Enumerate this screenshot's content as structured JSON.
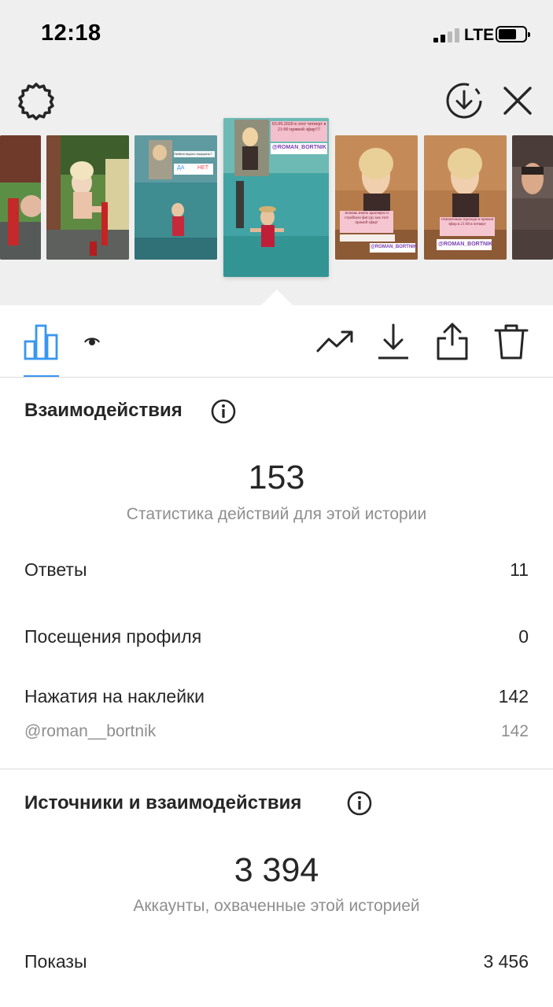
{
  "status_bar": {
    "time": "12:18",
    "network": "LTE"
  },
  "top_bar": {
    "left_icon": "gear-icon",
    "right_icons": [
      "download-circle-icon",
      "close-icon"
    ]
  },
  "story_thumbnails": [
    {
      "name": "story-thumb-1",
      "sticker_text": ""
    },
    {
      "name": "story-thumb-2",
      "sticker_text": ""
    },
    {
      "name": "story-thumb-3",
      "poll_question": "Любите вкусно покушать?",
      "poll_options": [
        "ДА",
        "НЕТ"
      ]
    },
    {
      "name": "story-thumb-4",
      "selected": true,
      "sticker_text": "03.09.2020 в этот четверг в 21:00 прямой эфир!!!",
      "mention": "@ROMAN_BORTNIK"
    },
    {
      "name": "story-thumb-5",
      "sticker_text": "Хочешь иметь красивую и стройную фигуру как этот прямой эфир!",
      "mention": "@ROMAN_BORTNIK"
    },
    {
      "name": "story-thumb-6",
      "sticker_text": "Обязательно приходи в прямой эфир в 21:00 в четверг",
      "mention": "@ROMAN_BORTNIK"
    },
    {
      "name": "story-thumb-7",
      "sticker_text": ""
    }
  ],
  "tabs": {
    "insights_icon": "bar-chart-icon",
    "viewers_icon": "eye-icon",
    "actions": [
      "trend-icon",
      "download-icon",
      "share-icon",
      "trash-icon"
    ]
  },
  "interactions": {
    "title": "Взаимодействия",
    "total": "153",
    "caption": "Статистика действий для этой истории",
    "rows": [
      {
        "label": "Ответы",
        "value": "11"
      },
      {
        "label": "Посещения профиля",
        "value": "0"
      },
      {
        "label": "Нажатия на наклейки",
        "value": "142"
      }
    ],
    "sub_rows": [
      {
        "label": "@roman__bortnik",
        "value": "142"
      }
    ]
  },
  "discovery": {
    "title": "Источники и взаимодействия",
    "total": "3 394",
    "caption": "Аккаунты, охваченные этой историей",
    "rows": [
      {
        "label": "Показы",
        "value": "3 456"
      }
    ]
  },
  "colors": {
    "accent": "#3897f0",
    "text": "#262626",
    "secondary": "#8e8e8e",
    "header_bg": "#efefef",
    "divider": "#dbdbdb"
  }
}
